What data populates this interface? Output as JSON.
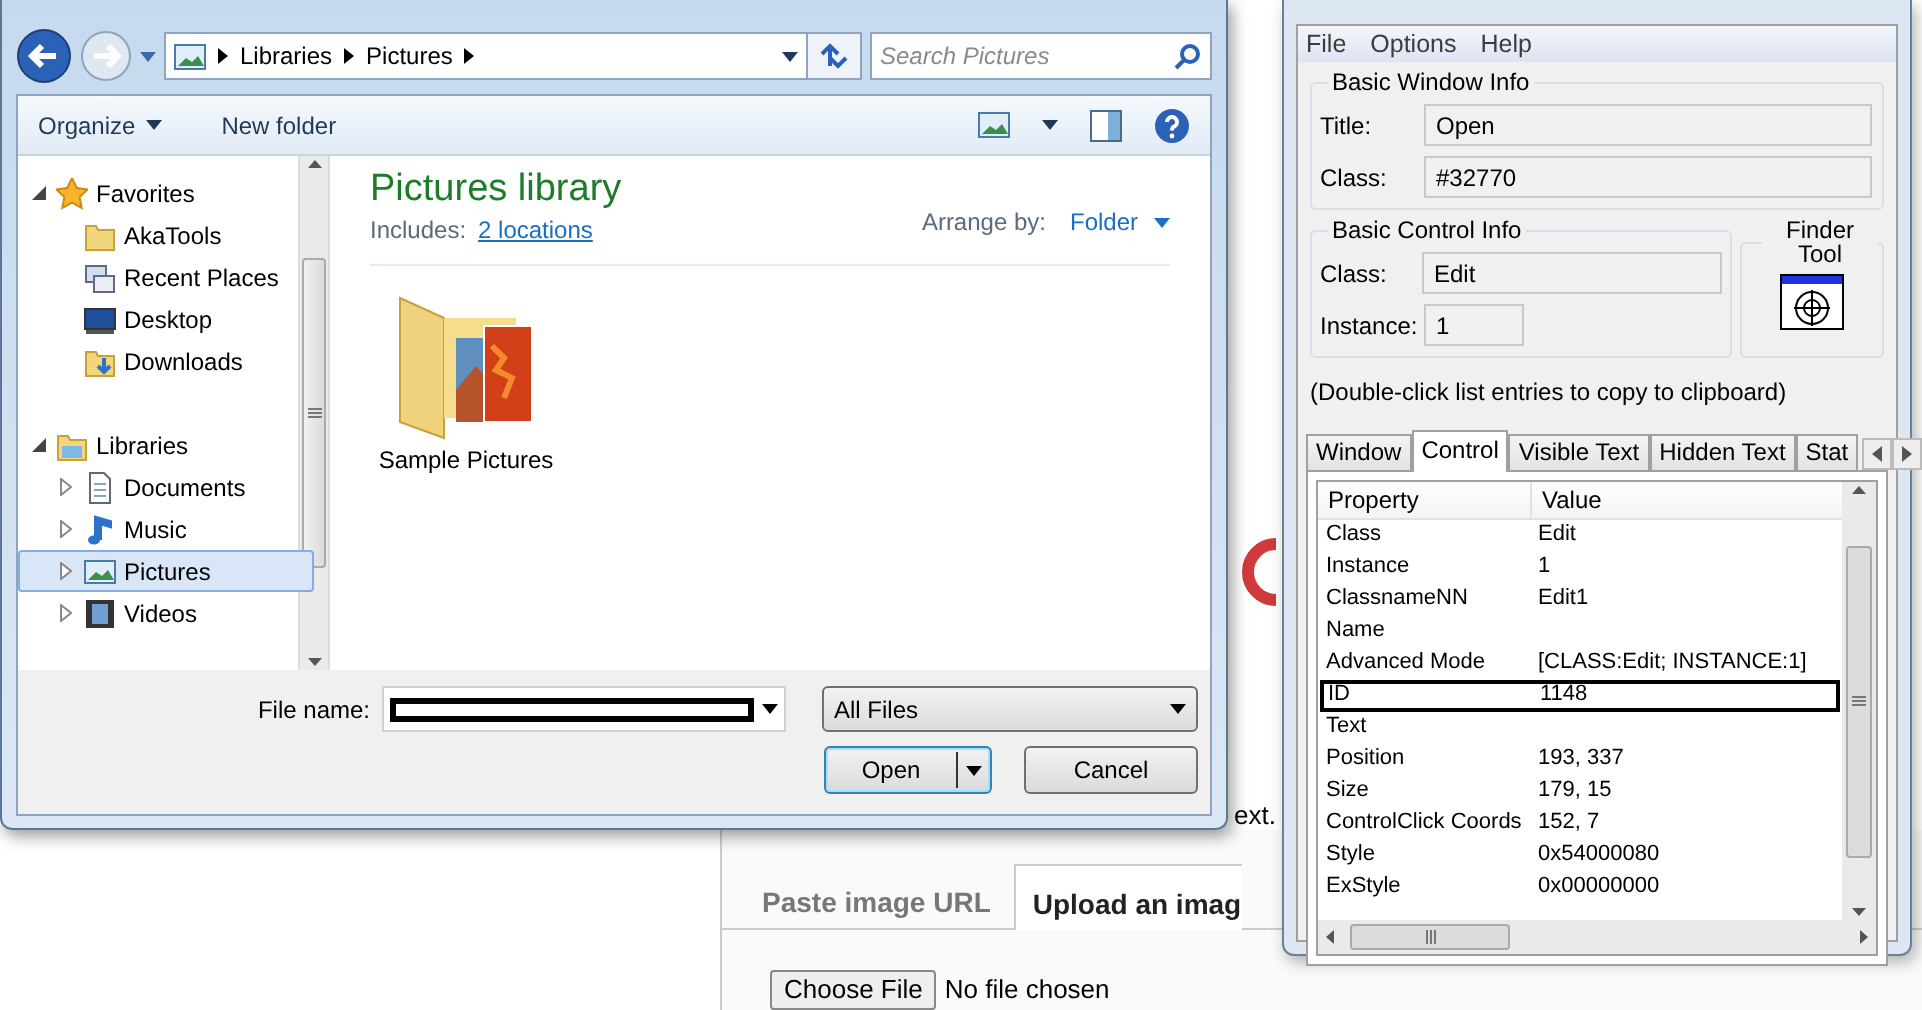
{
  "background_page": {
    "partial_text": "ext.",
    "tabs": [
      {
        "label": "Paste image URL",
        "selected": false
      },
      {
        "label": "Upload an imag",
        "selected": true
      }
    ],
    "file_button": "Choose File",
    "file_status": "No file chosen"
  },
  "open_dialog": {
    "breadcrumb": [
      "Libraries",
      "Pictures"
    ],
    "search": {
      "placeholder": "Search Pictures"
    },
    "toolbar": [
      {
        "label": "Organize",
        "kind": "menu"
      },
      {
        "label": "New folder",
        "kind": "plain"
      }
    ],
    "nav": [
      {
        "label": "Favorites",
        "kind": "star",
        "expanded": true,
        "selected": false,
        "children": [
          {
            "label": "AkaTools",
            "kind": "folder",
            "selected": false
          },
          {
            "label": "Recent Places",
            "kind": "recent",
            "selected": false
          },
          {
            "label": "Desktop",
            "kind": "desktop",
            "selected": false
          },
          {
            "label": "Downloads",
            "kind": "downloads",
            "selected": false
          }
        ]
      },
      {
        "label": "Libraries",
        "kind": "library",
        "expanded": true,
        "selected": false,
        "children": [
          {
            "label": "Documents",
            "kind": "documents",
            "expanded": false,
            "selected": false
          },
          {
            "label": "Music",
            "kind": "music",
            "expanded": false,
            "selected": false
          },
          {
            "label": "Pictures",
            "kind": "pictures",
            "expanded": false,
            "selected": true
          },
          {
            "label": "Videos",
            "kind": "videos",
            "expanded": false,
            "selected": false
          }
        ]
      }
    ],
    "library": {
      "title": "Pictures library",
      "includes_label": "Includes:",
      "includes_link": "2 locations",
      "arrange_label": "Arrange by:",
      "arrange_value": "Folder"
    },
    "items": [
      {
        "label": "Sample Pictures"
      }
    ],
    "file_name": {
      "label": "File name:",
      "redacted": true
    },
    "file_type": {
      "value": "All Files"
    },
    "buttons": [
      {
        "label": "Open",
        "kind": "split",
        "default": true
      },
      {
        "label": "Cancel",
        "kind": "plain",
        "default": false
      }
    ]
  },
  "window_info": {
    "menu": [
      "File",
      "Options",
      "Help"
    ],
    "basic_window": {
      "title": "Basic Window Info",
      "fields": [
        {
          "label": "Title:",
          "value": "Open"
        },
        {
          "label": "Class:",
          "value": "#32770"
        }
      ]
    },
    "basic_control": {
      "title": "Basic Control Info",
      "fields": [
        {
          "label": "Class:",
          "value": "Edit"
        },
        {
          "label": "Instance:",
          "value": "1"
        }
      ]
    },
    "finder": {
      "title": "Finder Tool"
    },
    "hint": "(Double-click list entries to copy to clipboard)",
    "tabs": [
      {
        "label": "Window",
        "selected": false
      },
      {
        "label": "Control",
        "selected": true
      },
      {
        "label": "Visible Text",
        "selected": false
      },
      {
        "label": "Hidden Text",
        "selected": false
      },
      {
        "label": "Stat",
        "selected": false
      }
    ],
    "table": {
      "columns": [
        "Property",
        "Value"
      ],
      "rows": [
        {
          "property": "Class",
          "value": "Edit",
          "outlined": false
        },
        {
          "property": "Instance",
          "value": "1",
          "outlined": false
        },
        {
          "property": "ClassnameNN",
          "value": "Edit1",
          "outlined": false
        },
        {
          "property": "Name",
          "value": "",
          "outlined": false
        },
        {
          "property": "Advanced Mode",
          "value": "[CLASS:Edit; INSTANCE:1]",
          "outlined": false
        },
        {
          "property": "ID",
          "value": "1148",
          "outlined": true
        },
        {
          "property": "Text",
          "value": "",
          "outlined": false
        },
        {
          "property": "Position",
          "value": "193, 337",
          "outlined": false
        },
        {
          "property": "Size",
          "value": "179, 15",
          "outlined": false
        },
        {
          "property": "ControlClick Coords",
          "value": "152, 7",
          "outlined": false
        },
        {
          "property": "Style",
          "value": "0x54000080",
          "outlined": false
        },
        {
          "property": "ExStyle",
          "value": "0x00000000",
          "outlined": false
        }
      ]
    }
  }
}
